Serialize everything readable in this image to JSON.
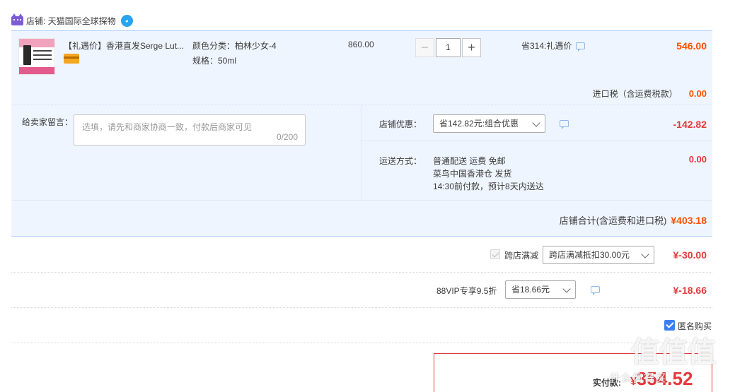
{
  "shop": {
    "label": "店铺: 天猫国际全球探物"
  },
  "item": {
    "title": "【礼遇价】香港直发Serge Lut...",
    "sku_color": "颜色分类：柏林少女-4",
    "sku_spec": "规格：50ml",
    "unit_price": "860.00",
    "quantity": "1",
    "qty_minus": "−",
    "qty_plus": "+",
    "discount_note": "省314:礼遇价",
    "total": "546.00",
    "tax_label": "进口税（含运费税款）",
    "tax_value": "0.00"
  },
  "order": {
    "memo_label": "给卖家留言：",
    "memo_placeholder": "选填，请先和商家协商一致，付款后商家可见",
    "memo_count": "0/200",
    "shop_discount_label": "店铺优惠：",
    "shop_discount_selected": "省142.82元:组合优惠",
    "shop_discount_value": "-142.82",
    "shipping_label": "运送方式：",
    "shipping_line1": "普通配送 运费 免邮",
    "shipping_line2": "菜鸟中国香港仓   发货",
    "shipping_line3": "14:30前付款，预计8天内送达",
    "shipping_value": "0.00",
    "shop_total_label": "店铺合计(含运费和进口税)",
    "shop_total_value": "¥403.18"
  },
  "cross_shop": {
    "label": "跨店满减",
    "selected": "跨店满减抵扣30.00元",
    "value": "¥-30.00",
    "checked": true
  },
  "vip": {
    "label": "88VIP专享9.5折",
    "selected": "省18.66元",
    "value": "¥-18.66"
  },
  "anonymous": {
    "label": "匿名购买",
    "checked": true
  },
  "payment": {
    "label": "实付款:",
    "currency": "¥",
    "value": "354.52"
  },
  "watermark": {
    "logo": "值值值",
    "url": "什么值得买"
  },
  "colors": {
    "accent_orange": "#ff5000",
    "accent_red": "#e4393c",
    "panel_bg": "#eff5fe",
    "border_blue": "#b2d1ff",
    "check_blue": "#3d7ff2"
  }
}
